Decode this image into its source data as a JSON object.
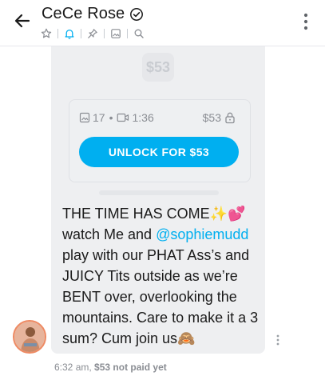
{
  "header": {
    "title": "CeCe Rose",
    "icons": [
      "star-icon",
      "bell-icon",
      "pin-icon",
      "image-icon",
      "search-icon"
    ],
    "accent": "#00aff0"
  },
  "locked_post": {
    "blurred_price": "$53",
    "media_count": "17",
    "video_duration": "1:36",
    "price": "$53",
    "unlock_label": "UNLOCK FOR $53"
  },
  "message": {
    "text_part1": "THE TIME HAS COME✨💕 watch Me and ",
    "mention": "@sophiemudd",
    "text_part2": " play with our PHAT Ass’s and JUICY Tits outside as we’re BENT over, overlooking the mountains. Care to make it a 3 sum? Cum join us🙈"
  },
  "meta": {
    "time": "6:32 am,",
    "status": "$53 not paid yet"
  }
}
